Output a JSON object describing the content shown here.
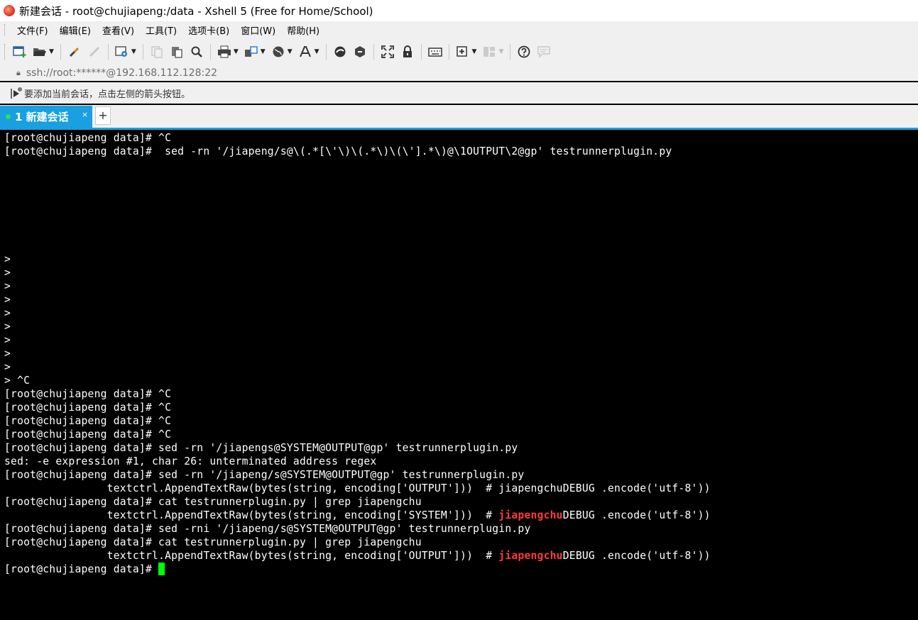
{
  "window": {
    "title": "新建会话 - root@chujiapeng:/data - Xshell 5 (Free for Home/School)"
  },
  "menu": [
    "文件(F)",
    "编辑(E)",
    "查看(V)",
    "工具(T)",
    "选项卡(B)",
    "窗口(W)",
    "帮助(H)"
  ],
  "address": "ssh://root:******@192.168.112.128:22",
  "hint": "要添加当前会话，点击左侧的箭头按钮。",
  "tabs": [
    {
      "label": "1 新建会话",
      "close": "×",
      "status_color": "#29e35a"
    }
  ],
  "new_tab": "+",
  "colors": {
    "accent": "#1a9fe0",
    "highlight": "#ff3a3a",
    "cursor": "#00ff00"
  },
  "terminal": {
    "lines": [
      {
        "text": "[root@chujiapeng data]# ^C"
      },
      {
        "text": "[root@chujiapeng data]#  sed -rn '/jiapeng/s@\\(.*[\\'\\)\\(.*\\)\\(\\'].*\\)@\\1OUTPUT\\2@gp' testrunnerplugin.py"
      },
      {
        "text": ""
      },
      {
        "text": ""
      },
      {
        "text": ""
      },
      {
        "text": ""
      },
      {
        "text": ""
      },
      {
        "text": ""
      },
      {
        "text": ""
      },
      {
        "text": ">"
      },
      {
        "text": ">"
      },
      {
        "text": ">"
      },
      {
        "text": ">"
      },
      {
        "text": ">"
      },
      {
        "text": ">"
      },
      {
        "text": ">"
      },
      {
        "text": ">"
      },
      {
        "text": ">"
      },
      {
        "text": "> ^C"
      },
      {
        "text": "[root@chujiapeng data]# ^C"
      },
      {
        "text": "[root@chujiapeng data]# ^C"
      },
      {
        "text": "[root@chujiapeng data]# ^C"
      },
      {
        "text": "[root@chujiapeng data]# ^C"
      },
      {
        "text": "[root@chujiapeng data]# sed -rn '/jiapengs@SYSTEM@OUTPUT@gp' testrunnerplugin.py"
      },
      {
        "text": "sed: -e expression #1, char 26: unterminated address regex"
      },
      {
        "text": "[root@chujiapeng data]# sed -rn '/jiapeng/s@SYSTEM@OUTPUT@gp' testrunnerplugin.py"
      },
      {
        "text": "                textctrl.AppendTextRaw(bytes(string, encoding['OUTPUT']))  # jiapengchuDEBUG .encode('utf-8'))"
      },
      {
        "text": "[root@chujiapeng data]# cat testrunnerplugin.py | grep jiapengchu"
      },
      {
        "pre": "                textctrl.AppendTextRaw(bytes(string, encoding['SYSTEM']))  # ",
        "hl": "jiapengchu",
        "post": "DEBUG .encode('utf-8'))"
      },
      {
        "text": "[root@chujiapeng data]# sed -rni '/jiapeng/s@SYSTEM@OUTPUT@gp' testrunnerplugin.py"
      },
      {
        "text": "[root@chujiapeng data]# cat testrunnerplugin.py | grep jiapengchu"
      },
      {
        "pre": "                textctrl.AppendTextRaw(bytes(string, encoding['OUTPUT']))  # ",
        "hl": "jiapengchu",
        "post": "DEBUG .encode('utf-8'))"
      },
      {
        "text": "[root@chujiapeng data]# ",
        "cursor": true
      }
    ]
  }
}
